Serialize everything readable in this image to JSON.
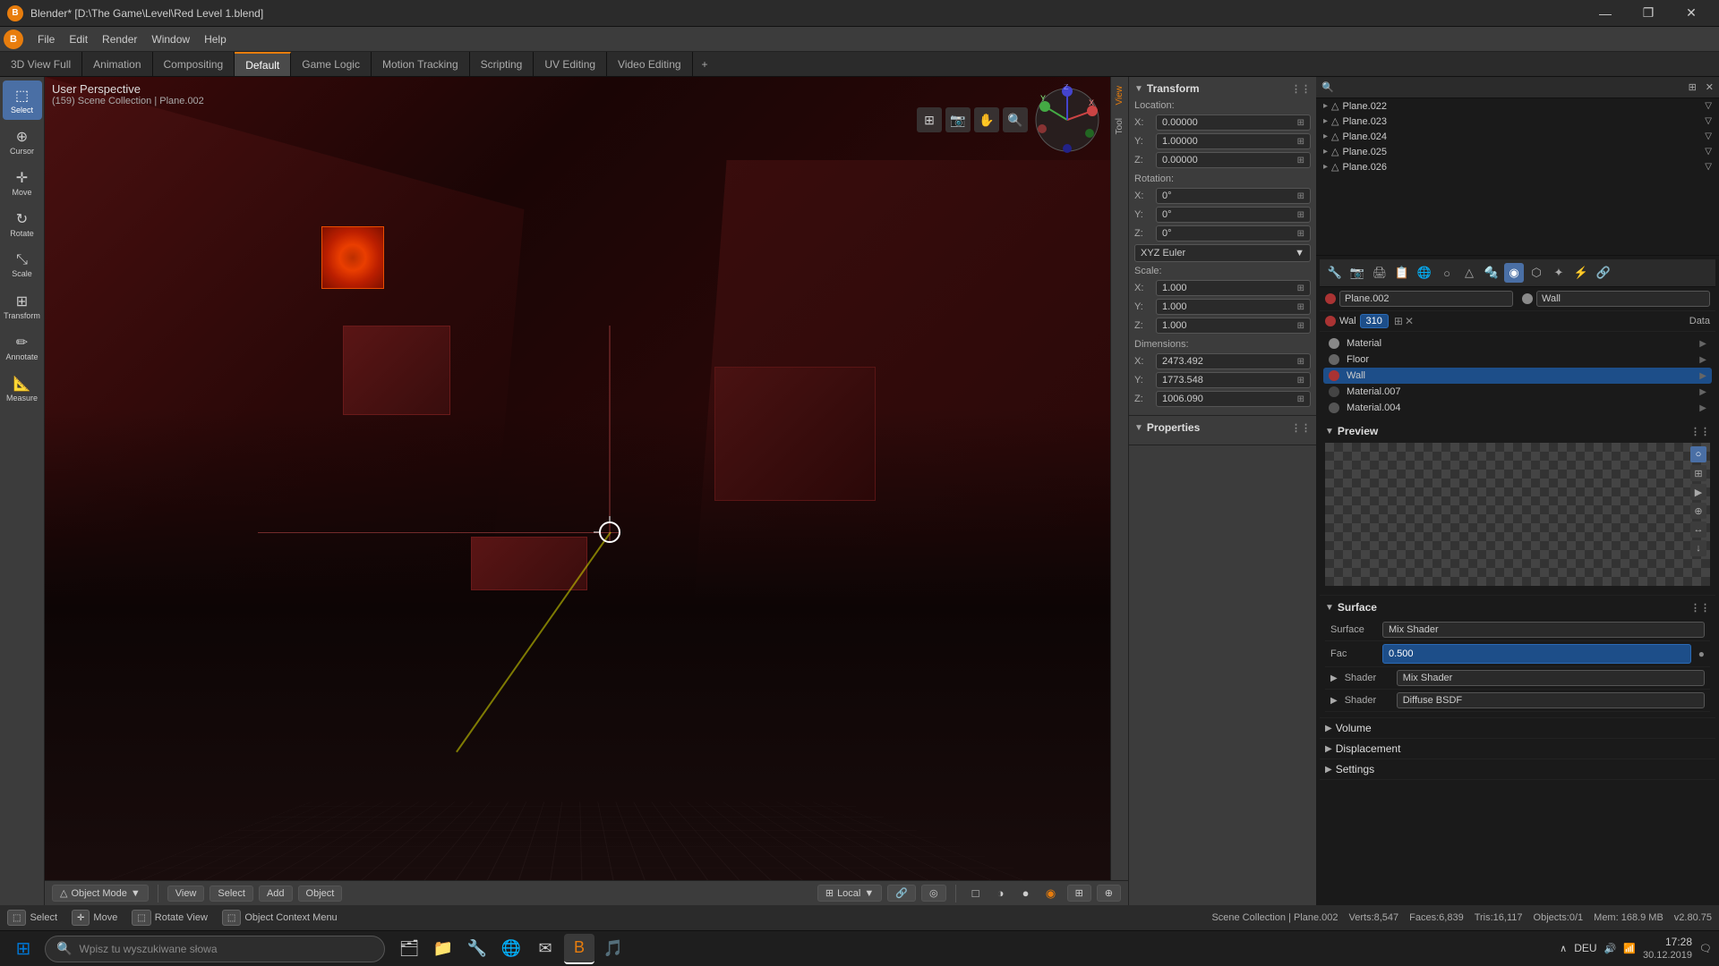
{
  "titlebar": {
    "title": "Blender* [D:\\The Game\\Level\\Red Level 1.blend]",
    "logo": "B",
    "min_btn": "—",
    "max_btn": "❐",
    "close_btn": "✕"
  },
  "menubar": {
    "logo": "B",
    "items": [
      "File",
      "Edit",
      "Render",
      "Window",
      "Help"
    ]
  },
  "tabbar": {
    "tabs": [
      {
        "label": "3D View Full",
        "active": false
      },
      {
        "label": "Animation",
        "active": false
      },
      {
        "label": "Compositing",
        "active": false
      },
      {
        "label": "Default",
        "active": true
      },
      {
        "label": "Game Logic",
        "active": false
      },
      {
        "label": "Motion Tracking",
        "active": false
      },
      {
        "label": "Scripting",
        "active": false
      },
      {
        "label": "UV Editing",
        "active": false
      },
      {
        "label": "Video Editing",
        "active": false
      }
    ],
    "add_label": "+"
  },
  "toolbar": {
    "tools": [
      {
        "id": "select",
        "icon": "⬚",
        "label": "Select",
        "active": true
      },
      {
        "id": "cursor",
        "icon": "⊕",
        "label": "Cursor",
        "active": false
      },
      {
        "id": "move",
        "icon": "✛",
        "label": "Move",
        "active": false
      },
      {
        "id": "rotate",
        "icon": "↻",
        "label": "Rotate",
        "active": false
      },
      {
        "id": "scale",
        "icon": "⤡",
        "label": "Scale",
        "active": false
      },
      {
        "id": "transform",
        "icon": "⊞",
        "label": "Transform",
        "active": false
      },
      {
        "id": "annotate",
        "icon": "✏",
        "label": "Annotate",
        "active": false
      },
      {
        "id": "measure",
        "icon": "📐",
        "label": "Measure",
        "active": false
      }
    ]
  },
  "viewport": {
    "perspective_label": "User Perspective",
    "collection_label": "(159) Scene Collection | Plane.002"
  },
  "transform_panel": {
    "title": "Transform",
    "location": {
      "x": "0.00000",
      "y": "1.00000",
      "z": "0.00000"
    },
    "rotation_label": "Rotation:",
    "rotation": {
      "x": "0°",
      "y": "0°",
      "z": "0°"
    },
    "rotation_type": "XYZ Euler",
    "scale_label": "Scale:",
    "scale": {
      "x": "1.000",
      "y": "1.000",
      "z": "1.000"
    },
    "dimensions_label": "Dimensions:",
    "dimensions": {
      "x": "2473.492",
      "y": "1773.548",
      "z": "1006.090"
    },
    "properties_label": "Properties"
  },
  "side_tabs": {
    "view_label": "View",
    "tool_label": "Tool"
  },
  "outliner": {
    "items": [
      {
        "name": "Plane.022",
        "indent": 0
      },
      {
        "name": "Plane.023",
        "indent": 0
      },
      {
        "name": "Plane.024",
        "indent": 0
      },
      {
        "name": "Plane.025",
        "indent": 0
      },
      {
        "name": "Plane.026",
        "indent": 0
      }
    ]
  },
  "props_header": {
    "object_name": "Plane.002",
    "material_name": "Wall"
  },
  "materials": {
    "list": [
      {
        "name": "Material",
        "color": "#888888",
        "selected": false
      },
      {
        "name": "Floor",
        "color": "#666666",
        "selected": false
      },
      {
        "name": "Wall",
        "color": "#aa3333",
        "selected": true
      },
      {
        "name": "Material.007",
        "color": "#444444",
        "selected": false
      },
      {
        "name": "Material.004",
        "color": "#555555",
        "selected": false
      }
    ],
    "wall_input_name": "Wal",
    "wall_input_num": "310",
    "data_label": "Data"
  },
  "preview": {
    "title": "Preview"
  },
  "surface": {
    "title": "Surface",
    "surface_label": "Surface",
    "surface_value": "Mix Shader",
    "fac_label": "Fac",
    "fac_value": "0.500",
    "shader1_label": "Shader",
    "shader1_value": "Mix Shader",
    "shader2_label": "Shader",
    "shader2_value": "Diffuse BSDF"
  },
  "volume": {
    "label": "Volume"
  },
  "displacement": {
    "label": "Displacement"
  },
  "settings": {
    "label": "Settings"
  },
  "statusbar": {
    "collection_label": "Scene Collection | Plane.002",
    "verts": "Verts:8,547",
    "faces": "Faces:6,839",
    "tris": "Tris:16,117",
    "objects": "Objects:0/1",
    "mem": "Mem: 168.9 MB",
    "version": "v2.80.75"
  },
  "shortcutbar": {
    "items": [
      {
        "key": "Select",
        "action": "Select"
      },
      {
        "key": "Move",
        "action": "Move"
      },
      {
        "key": "Rotate View",
        "action": "Rotate View"
      },
      {
        "key": "Object Context Menu",
        "action": "Object Context Menu"
      }
    ]
  },
  "viewport_footer": {
    "mode_label": "Object Mode",
    "view_label": "View",
    "select_label": "Select",
    "add_label": "Add",
    "object_label": "Object",
    "snap_label": "Local"
  },
  "taskbar": {
    "search_placeholder": "Wpisz tu wyszukiwane słowa",
    "time": "17:28",
    "date": "30.12.2019",
    "lang": "DEU",
    "apps": [
      "🗂",
      "📁",
      "🔧",
      "🌐",
      "✉",
      "🎨",
      "🎵"
    ]
  }
}
